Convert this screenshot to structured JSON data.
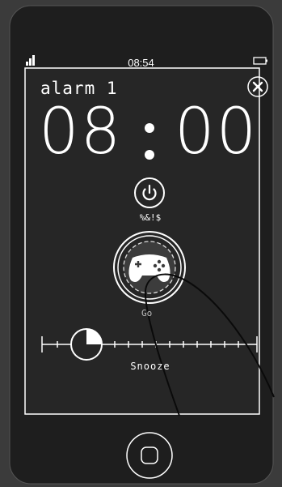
{
  "status_bar": {
    "time": "08:54",
    "signal_icon": "signal-bars-icon",
    "battery_icon": "battery-icon"
  },
  "alarm": {
    "label": "alarm 1",
    "hours": "08",
    "separator": ":",
    "minutes": "00",
    "close_icon": "close-icon"
  },
  "power": {
    "icon": "power-icon",
    "caption": "%&!$"
  },
  "game": {
    "icon": "gamepad-icon",
    "label": "Go"
  },
  "snooze": {
    "label": "Snooze",
    "progress": 0.25
  },
  "device": {
    "home_icon": "home-button-icon"
  },
  "colors": {
    "background": "#3b3b3b",
    "phone_body": "#1e1e1e",
    "screen": "#262626",
    "foreground": "#ffffff"
  }
}
